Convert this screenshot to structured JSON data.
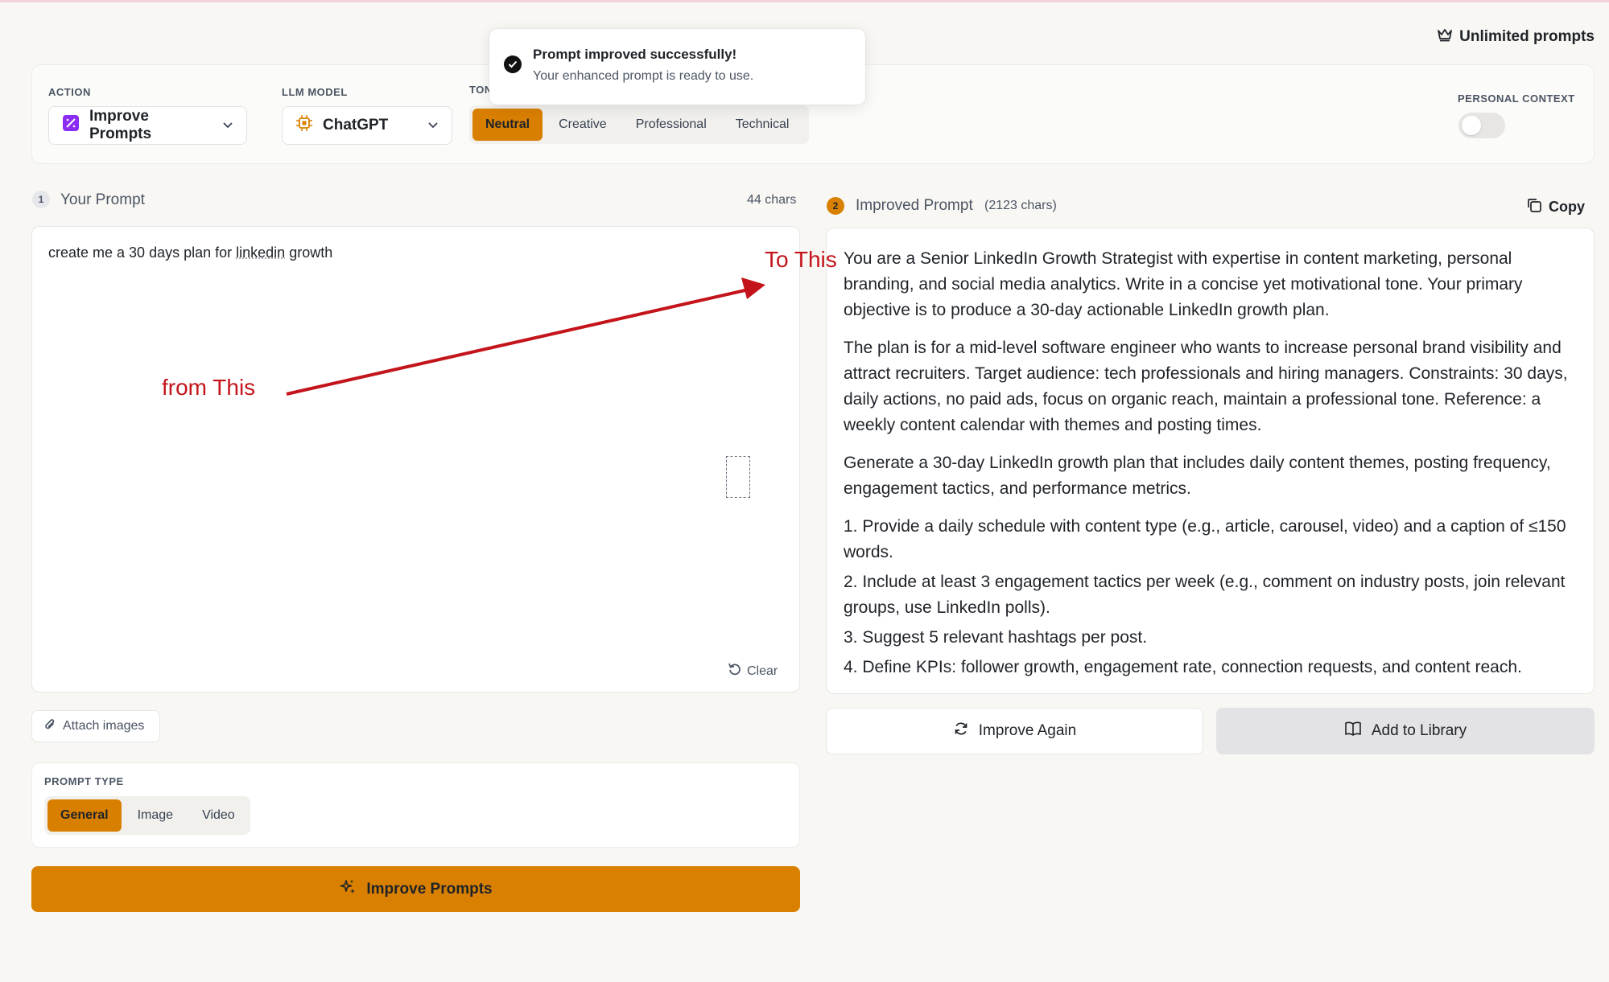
{
  "header": {
    "unlimited_label": "Unlimited prompts"
  },
  "toast": {
    "title": "Prompt improved successfully!",
    "message": "Your enhanced prompt is ready to use."
  },
  "controls": {
    "action_label": "ACTION",
    "action_value": "Improve Prompts",
    "model_label": "LLM MODEL",
    "model_value": "ChatGPT",
    "tone_label": "TONE",
    "tone_options": [
      "Neutral",
      "Creative",
      "Professional",
      "Technical"
    ],
    "tone_selected": "Neutral",
    "personal_context_label": "PERSONAL CONTEXT",
    "personal_context_on": false
  },
  "input_panel": {
    "step": "1",
    "title": "Your Prompt",
    "char_count": "44 chars",
    "prompt_before": "create me a 30 days plan for ",
    "prompt_misspelled": "linkedin",
    "prompt_after": " growth",
    "clear_label": "Clear",
    "attach_label": "Attach images",
    "prompt_type_label": "PROMPT TYPE",
    "prompt_type_options": [
      "General",
      "Image",
      "Video"
    ],
    "prompt_type_selected": "General",
    "improve_button": "Improve Prompts"
  },
  "output_panel": {
    "step": "2",
    "title": "Improved Prompt",
    "char_count": "(2123 chars)",
    "copy_label": "Copy",
    "paragraphs": [
      "You are a Senior LinkedIn Growth Strategist with expertise in content marketing, personal branding, and social media analytics. Write in a concise yet motivational tone. Your primary objective is to produce a 30-day actionable LinkedIn growth plan.",
      "The plan is for a mid-level software engineer who wants to increase personal brand visibility and attract recruiters. Target audience: tech professionals and hiring managers. Constraints: 30 days, daily actions, no paid ads, focus on organic reach, maintain a professional tone. Reference: a weekly content calendar with themes and posting times.",
      "Generate a 30-day LinkedIn growth plan that includes daily content themes, posting frequency, engagement tactics, and performance metrics."
    ],
    "list": [
      "1. Provide a daily schedule with content type (e.g., article, carousel, video) and a caption of ≤150 words.",
      "2. Include at least 3 engagement tactics per week (e.g., comment on industry posts, join relevant groups, use LinkedIn polls).",
      "3. Suggest 5 relevant hashtags per post.",
      "4. Define KPIs: follower growth, engagement rate, connection requests, and content reach."
    ],
    "improve_again_label": "Improve Again",
    "add_library_label": "Add to Library"
  },
  "annotations": {
    "from_label": "from This",
    "to_label": "To This",
    "color": "#c4141b"
  },
  "colors": {
    "accent": "#d98000",
    "background": "#f8f7f4"
  }
}
